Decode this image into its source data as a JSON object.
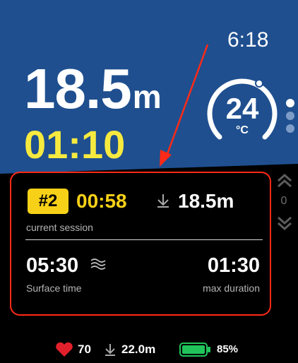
{
  "status": {
    "clock": "6:18"
  },
  "dive": {
    "depth_value": "18.5",
    "depth_unit": "m",
    "dive_time": "01:10"
  },
  "temperature": {
    "value": "24",
    "unit": "°C"
  },
  "session": {
    "number_badge": "#2",
    "duration": "00:58",
    "depth": "18.5m",
    "label": "current session",
    "surface_time": "05:30",
    "surface_label": "Surface time",
    "max_duration": "01:30",
    "max_duration_label": "max duration"
  },
  "scroll": {
    "index": "0"
  },
  "footer": {
    "heart_rate": "70",
    "max_depth": "22.0m",
    "battery": "85%"
  },
  "colors": {
    "top_bg": "#1f4f8f",
    "accent_yellow": "#f7ea3f",
    "badge_yellow": "#f7d117",
    "highlight_red": "#ff2a17",
    "battery_green": "#21c45a"
  }
}
